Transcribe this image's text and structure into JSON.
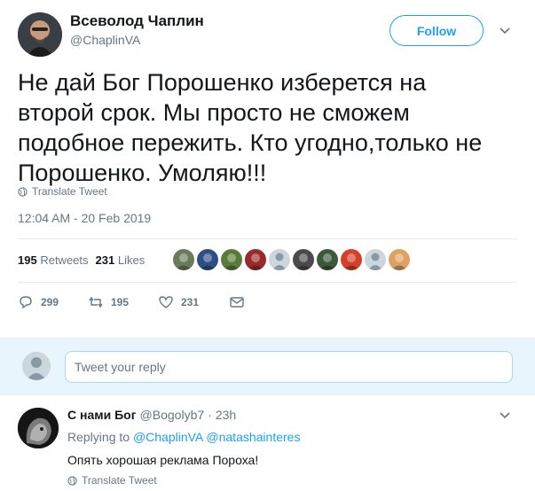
{
  "author": {
    "name": "Всеволод Чаплин",
    "handle": "@ChaplinVA",
    "avatar_icon": "author-portrait-avatar"
  },
  "follow_label": "Follow",
  "tweet": {
    "lines": [
      "Не дай Бог Порошенко изберется на",
      "второй срок. Мы просто не сможем",
      "подобное пережить. Кто угодно,только не",
      "Порошенко. Умоляю!!!"
    ],
    "translate_label": "Translate Tweet",
    "timestamp": "12:04 AM - 20 Feb 2019"
  },
  "stats": {
    "retweets_count": "195",
    "retweets_label": "Retweets",
    "likes_count": "231",
    "likes_label": "Likes"
  },
  "likers": [
    {
      "icon": "liker-avatar-1",
      "color": "#6b7a5a"
    },
    {
      "icon": "liker-avatar-2",
      "color": "#2e4f86"
    },
    {
      "icon": "liker-avatar-3",
      "color": "#5a7a3a"
    },
    {
      "icon": "liker-avatar-4",
      "color": "#9a2a2a"
    },
    {
      "icon": "liker-avatar-default",
      "color": "#ccd6dd"
    },
    {
      "icon": "liker-avatar-5",
      "color": "#4a4a4a"
    },
    {
      "icon": "liker-avatar-6",
      "color": "#3a5a3a"
    },
    {
      "icon": "liker-avatar-7",
      "color": "#d4402a"
    },
    {
      "icon": "liker-avatar-default",
      "color": "#ccd6dd"
    },
    {
      "icon": "liker-avatar-8",
      "color": "#e0a060"
    }
  ],
  "actions": {
    "reply_count": "299",
    "retweet_count": "195",
    "like_count": "231"
  },
  "reply_box": {
    "placeholder": "Tweet your reply"
  },
  "reply": {
    "name": "С нами Бог",
    "handle": "@Bogolyb7",
    "separator": "·",
    "time": "23h",
    "replying_prefix": "Replying to",
    "mention_1": "@ChaplinVA",
    "mention_2": "@natashainteres",
    "text": "Опять хорошая реклама Пороха!",
    "translate_label": "Translate Tweet"
  },
  "colors": {
    "accent": "#1da1f2",
    "secondary_text": "#657786",
    "primary_text": "#14171a",
    "reply_bg": "#e8f5fd"
  }
}
